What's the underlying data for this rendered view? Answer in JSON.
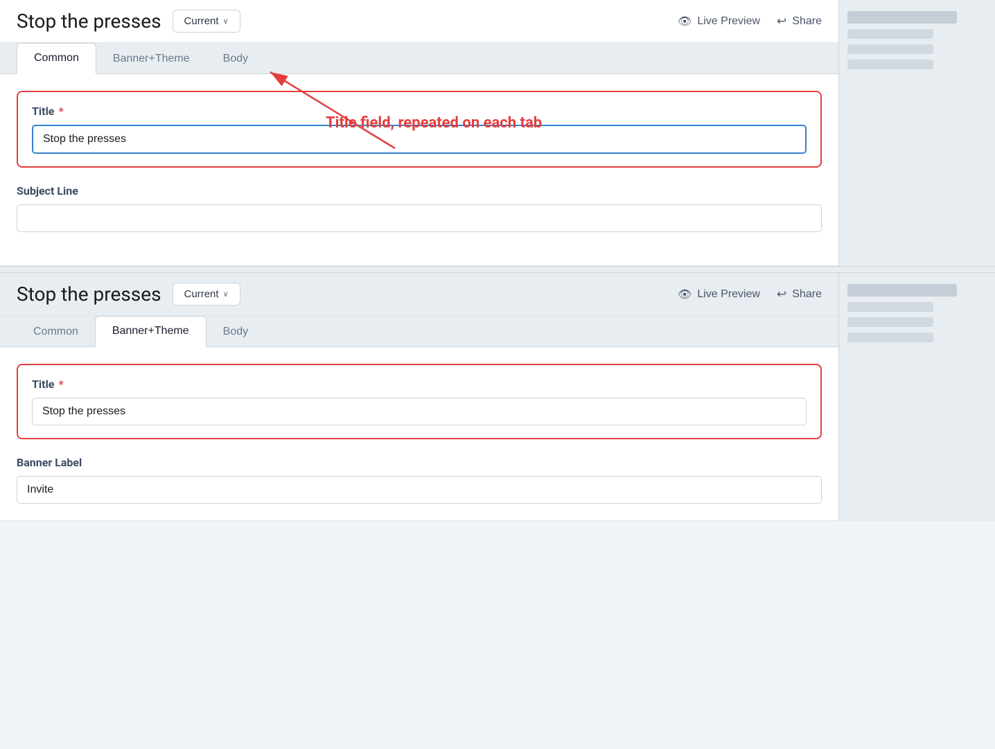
{
  "panel1": {
    "title": "Stop the presses",
    "version": {
      "label": "Current",
      "chevron": "∨"
    },
    "actions": {
      "live_preview": "Live Preview",
      "share": "Share"
    },
    "tabs": [
      {
        "id": "common",
        "label": "Common",
        "active": true
      },
      {
        "id": "banner-theme",
        "label": "Banner+Theme",
        "active": false
      },
      {
        "id": "body",
        "label": "Body",
        "active": false
      }
    ],
    "fields": {
      "title_label": "Title",
      "title_required": "*",
      "title_value": "Stop the presses",
      "title_placeholder": "",
      "subject_label": "Subject Line",
      "subject_value": "",
      "subject_placeholder": ""
    }
  },
  "annotation": {
    "text": "Title field, repeated on each tab"
  },
  "panel2": {
    "title": "Stop the presses",
    "version": {
      "label": "Current",
      "chevron": "∨"
    },
    "actions": {
      "live_preview": "Live Preview",
      "share": "Share"
    },
    "tabs": [
      {
        "id": "common",
        "label": "Common",
        "active": false
      },
      {
        "id": "banner-theme",
        "label": "Banner+Theme",
        "active": true
      },
      {
        "id": "body",
        "label": "Body",
        "active": false
      }
    ],
    "fields": {
      "title_label": "Title",
      "title_required": "*",
      "title_value": "Stop the presses",
      "banner_label": "Banner Label",
      "banner_value": "Invite"
    }
  },
  "icons": {
    "eye": "👁",
    "share_arrow": "↪",
    "chevron_down": "∨"
  }
}
